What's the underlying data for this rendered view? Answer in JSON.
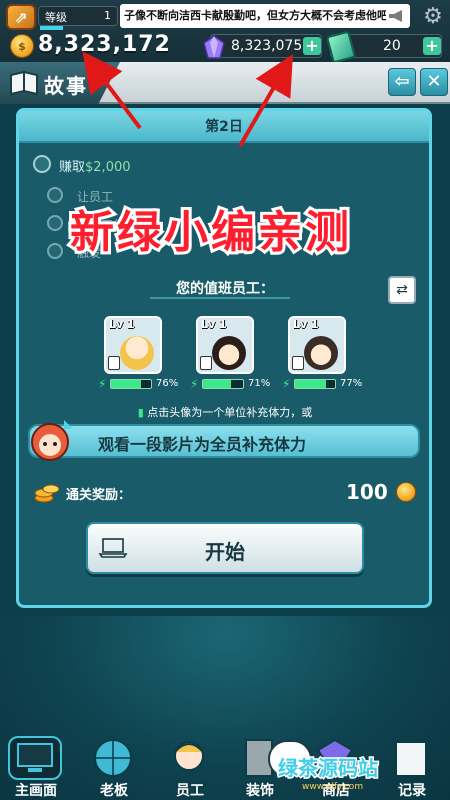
{
  "topbar": {
    "level_label": "等级",
    "level_value": "1",
    "ticker": "子像不断向洁西卡献殷勤吧，但女方大概不会考虑他吧",
    "gold": "8,323,172",
    "gems": "8,323,075",
    "tickets": "20"
  },
  "story": {
    "title": "故事"
  },
  "panel": {
    "day_title": "第2日",
    "task_earn_prefix": "赚取",
    "task_earn_value": "$2,000",
    "dim_rows": [
      "让员工",
      "完成工作",
      "触发"
    ],
    "overlay": "新绿小编亲测",
    "duty_title": "您的值班员工：",
    "employees": [
      {
        "lv": "Lv 1",
        "stamina": "76%",
        "fill": 0.76
      },
      {
        "lv": "Lv 1",
        "stamina": "71%",
        "fill": 0.71
      },
      {
        "lv": "Lv 1",
        "stamina": "77%",
        "fill": 0.77
      }
    ],
    "hint": "点击头像为一个单位补充体力，或",
    "watch_label": "观看一段影片为全员补充体力",
    "reward_label": "通关奖励：",
    "reward_value": "100",
    "start_label": "开始"
  },
  "nav": {
    "items": [
      "主画面",
      "老板",
      "员工",
      "装饰",
      "商店",
      "记录"
    ]
  },
  "watermark": {
    "text": "绿茶源码站",
    "sub": "www.xlfy.com"
  },
  "colors": {
    "panel_bg": "#195b68",
    "panel_border": "#5fd6e8",
    "overlay_red": "#ff1e2d",
    "stamina_green": "#3ee88a"
  }
}
